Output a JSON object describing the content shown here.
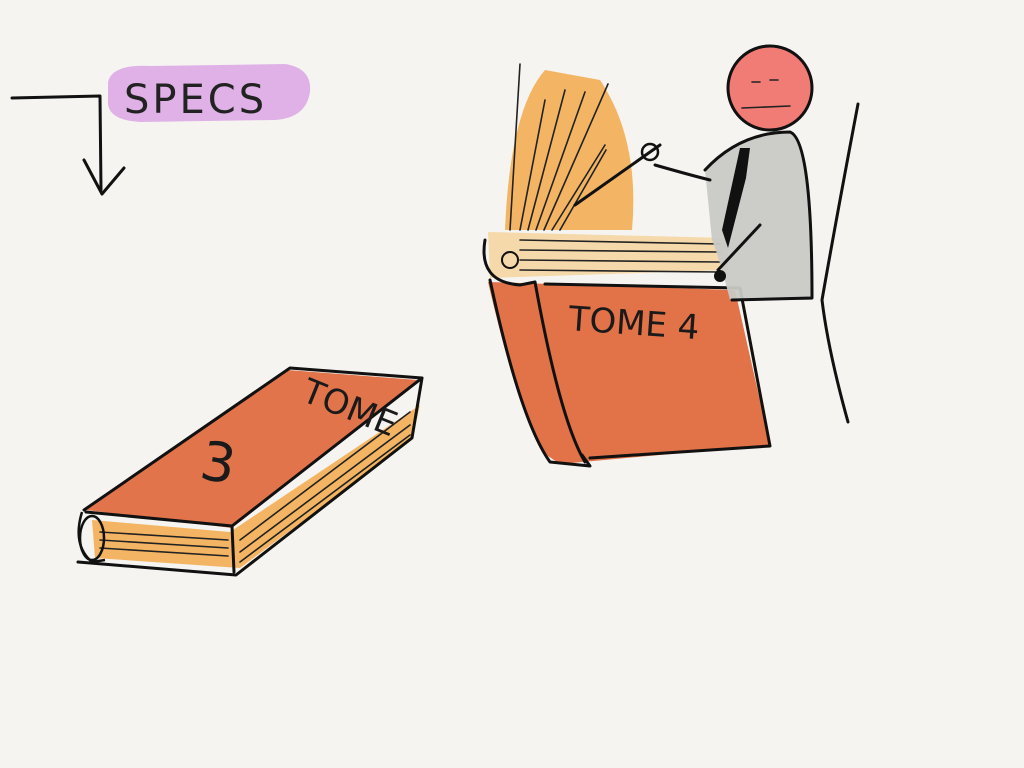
{
  "label_specs": "SPECS",
  "book_closed": {
    "title": "TOME",
    "number": "3"
  },
  "book_open": {
    "title": "TOME 4"
  },
  "colors": {
    "background": "#f5f4f1",
    "book_cover": "#e0663a",
    "book_pages": "#f2a94a",
    "specs_highlight": "#d79be3",
    "face": "#ef6f67",
    "suit": "#c9c9c6"
  }
}
